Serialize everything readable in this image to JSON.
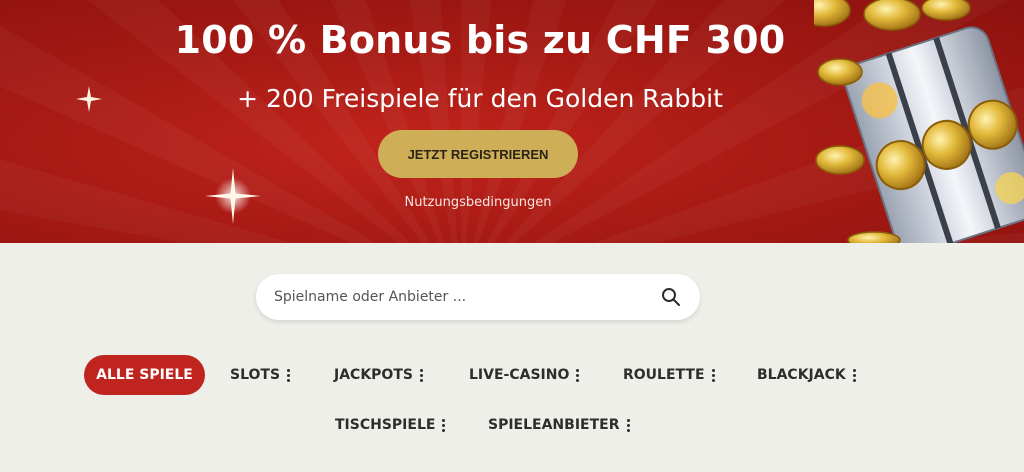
{
  "hero": {
    "title": "100 % Bonus bis zu CHF 300",
    "subtitle": "+ 200 Freispiele für den Golden Rabbit",
    "cta_label": "JETZT REGISTRIEREN",
    "terms_label": "Nutzungsbedingungen"
  },
  "search": {
    "placeholder": "Spielname oder Anbieter ..."
  },
  "categories": [
    {
      "label": "ALLE SPIELE",
      "active": true
    },
    {
      "label": "SLOTS"
    },
    {
      "label": "JACKPOTS"
    },
    {
      "label": "LIVE-CASINO"
    },
    {
      "label": "ROULETTE"
    },
    {
      "label": "BLACKJACK"
    },
    {
      "label": "TISCHSPIELE"
    },
    {
      "label": "SPIELEANBIETER"
    }
  ],
  "colors": {
    "hero_red": "#a81a14",
    "cta_gold": "#cfae58",
    "active_pill": "#c0241e",
    "page_bg": "#efefea"
  }
}
